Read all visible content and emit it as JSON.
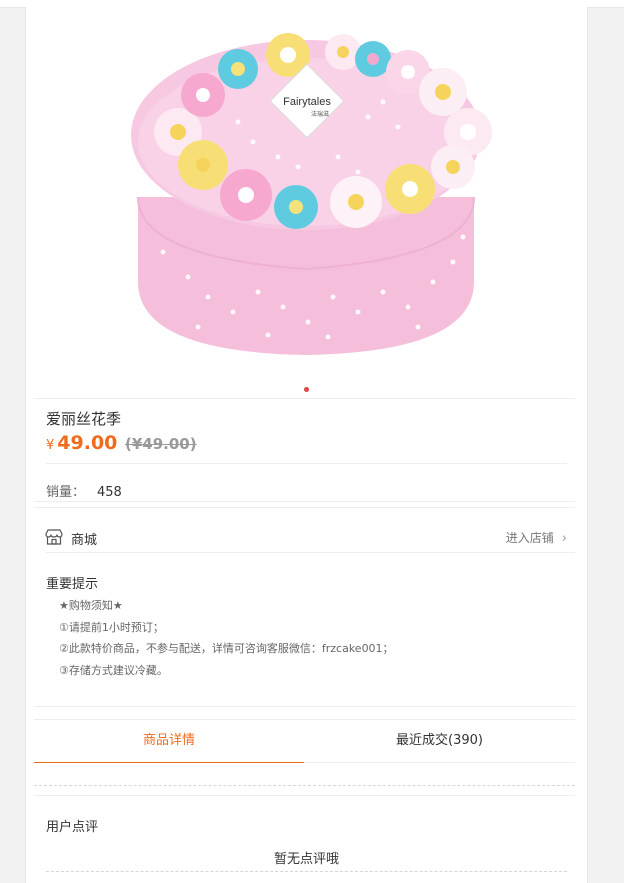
{
  "product": {
    "name": "爱丽丝花季",
    "currency_symbol": "¥",
    "price": "49.00",
    "original_price": "(¥49.00)",
    "image": {
      "brand_logo_text": "Fairytales",
      "brand_logo_cn": "法瑞滋"
    }
  },
  "sales": {
    "label": "销量：",
    "value": "458"
  },
  "shop": {
    "name": "商城",
    "enter_label": "进入店铺",
    "chevron": "›"
  },
  "notice": {
    "title": "重要提示",
    "lines": [
      "★购物须知★",
      "①请提前1小时预订；",
      "②此款特价商品，不参与配送，详情可咨询客服微信：frzcake001；",
      "③存储方式建议冷藏。"
    ]
  },
  "tabs": [
    {
      "label": "商品详情",
      "active": true
    },
    {
      "label": "最近成交(390)",
      "active": false
    }
  ],
  "reviews": {
    "title": "用户点评",
    "empty_text": "暂无点评哦"
  },
  "colors": {
    "accent": "#f06b1c",
    "dot_active": "#e64340",
    "cake_pink": "#f6c3dd"
  }
}
